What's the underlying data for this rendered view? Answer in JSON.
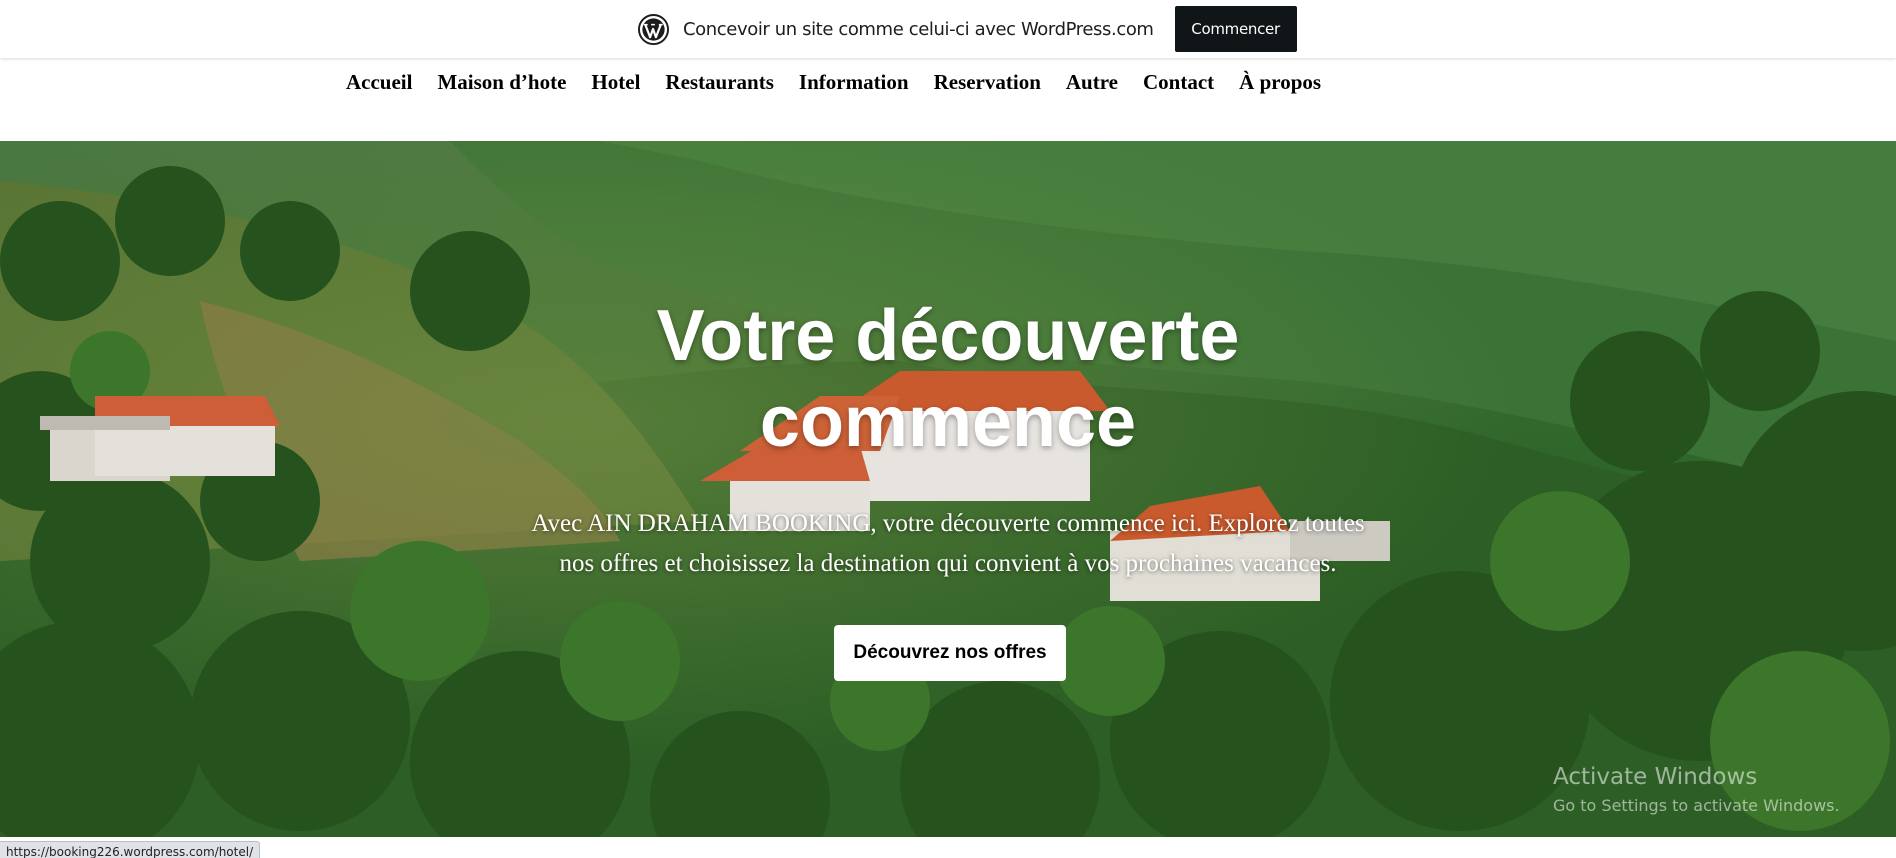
{
  "wp_bar": {
    "message": "Concevoir un site comme celui-ci avec WordPress.com",
    "button_label": "Commencer"
  },
  "nav": {
    "items": [
      "Accueil",
      "Maison d’hote",
      "Hotel",
      "Restaurants",
      "Information",
      "Reservation",
      "Autre",
      "Contact",
      "À propos"
    ]
  },
  "hero": {
    "title_line1": "Votre découverte",
    "title_line2": "commence",
    "subtitle_line1": "Avec AIN DRAHAM BOOKING, votre découverte commence ici. Explorez toutes",
    "subtitle_line2": "nos offres et choisissez la destination qui convient à vos prochaines vacances.",
    "button_label": "Découvrez nos offres"
  },
  "watermark": {
    "line1": "Activate Windows",
    "line2": "Go to Settings to activate Windows."
  },
  "status_bar": {
    "url": "https://booking226.wordpress.com/hotel/"
  },
  "colors": {
    "button_dark": "#101517",
    "nav_text": "#000000",
    "hero_text": "#ffffff"
  }
}
